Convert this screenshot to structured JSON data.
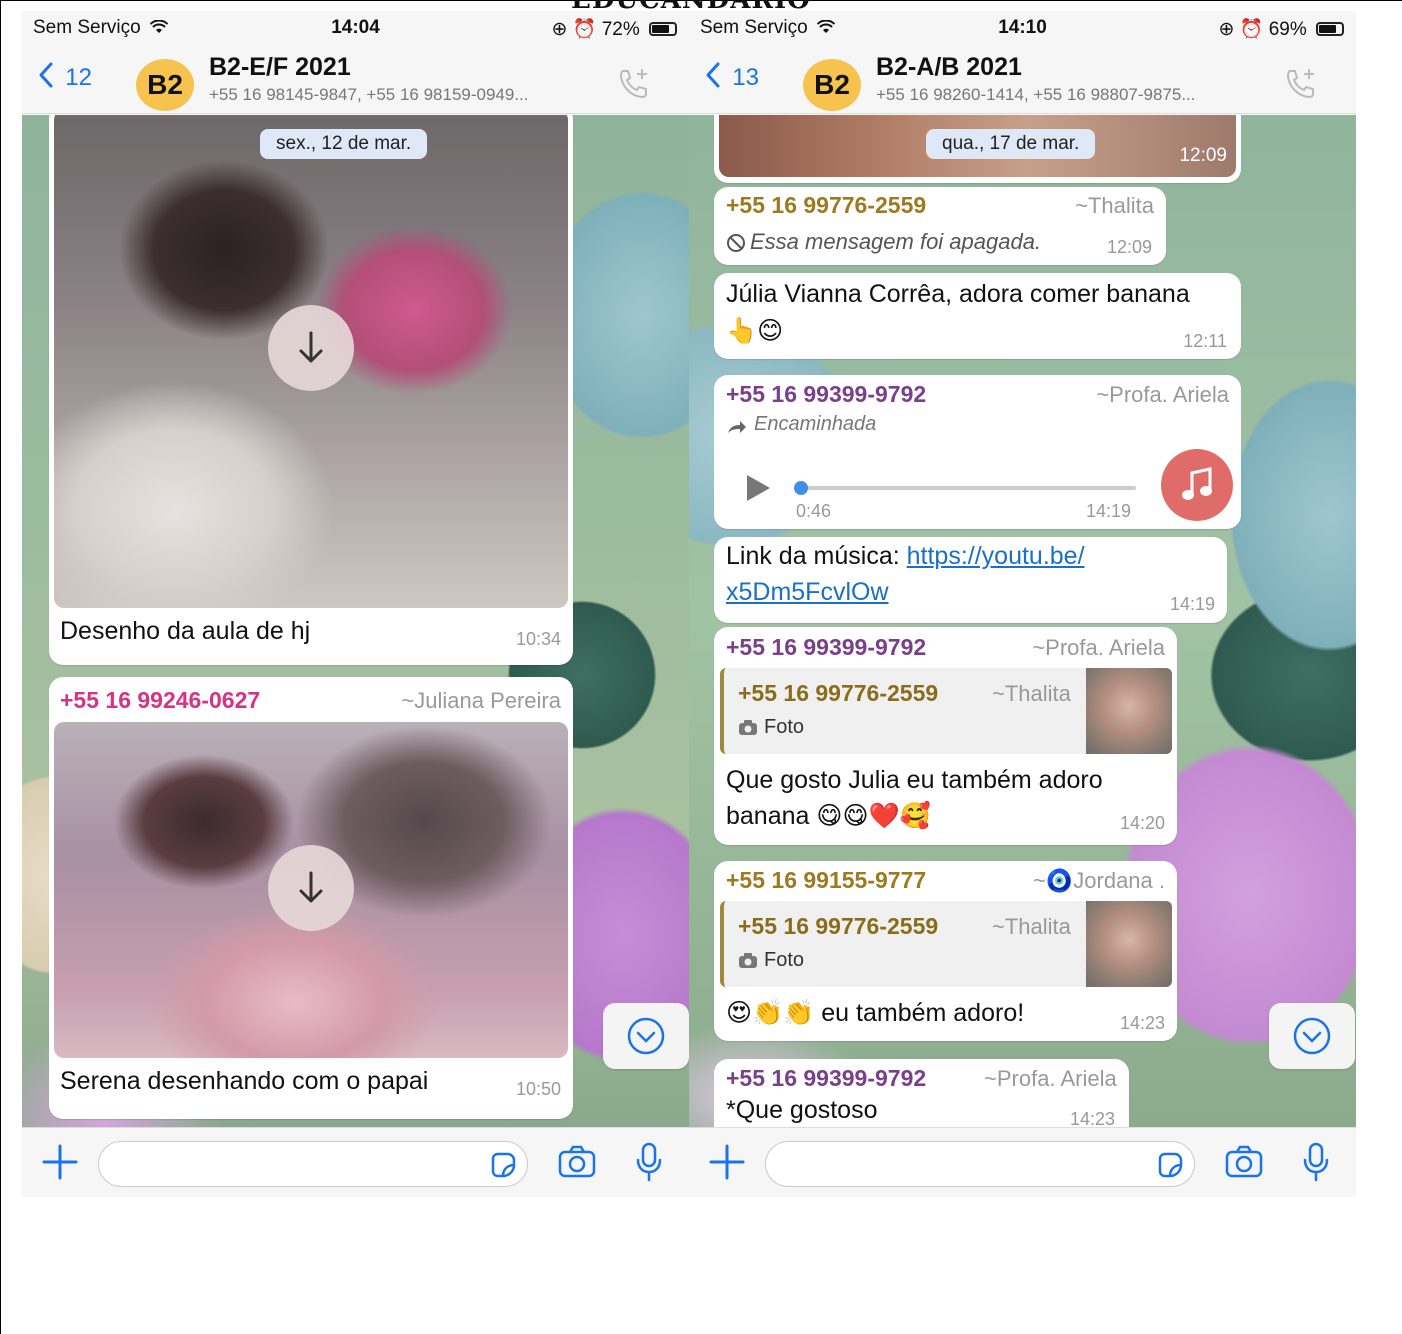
{
  "caption_top": "EDUCANDARIO",
  "left": {
    "status": {
      "carrier": "Sem Serviço",
      "time": "14:04",
      "battery": "72%",
      "battery_level": 0.72
    },
    "header": {
      "back_count": "12",
      "avatar": "B2",
      "title": "B2-E/F 2021",
      "subtitle": "+55 16 98145-9847, +55 16 98159-0949..."
    },
    "date_pill": "sex., 12 de mar.",
    "messages": [
      {
        "caption": "Desenho da aula de hj",
        "time": "10:34"
      },
      {
        "sender": "+55 16 99246-0627",
        "alias": "~Juliana Pereira",
        "caption": "Serena desenhando com o papai",
        "time": "10:50"
      }
    ]
  },
  "right": {
    "status": {
      "carrier": "Sem Serviço",
      "time": "14:10",
      "battery": "69%",
      "battery_level": 0.69
    },
    "header": {
      "back_count": "13",
      "avatar": "B2",
      "title": "B2-A/B 2021",
      "subtitle": "+55 16 98260-1414, +55 16 98807-9875..."
    },
    "date_pill": "qua., 17 de mar.",
    "top_image_time": "12:09",
    "messages": [
      {
        "sender": "+55 16 99776-2559",
        "alias": "~Thalita",
        "text": "Essa mensagem foi apagada.",
        "time": "12:09"
      },
      {
        "text": "Júlia Vianna Corrêa, adora comer banana",
        "emoji": "👆😊",
        "time": "12:11"
      },
      {
        "sender": "+55 16 99399-9792",
        "alias": "~Profa. Ariela",
        "forwarded": "Encaminhada",
        "duration": "0:46",
        "time": "14:19"
      },
      {
        "text_prefix": "Link da música: ",
        "link_line1": "https://youtu.be/",
        "link_line2": "x5Dm5FcvlOw",
        "time": "14:19"
      },
      {
        "sender": "+55 16 99399-9792",
        "alias": "~Profa. Ariela",
        "quote_sender": "+55 16 99776-2559",
        "quote_alias": "~Thalita",
        "quote_label": "Foto",
        "text_line1": "Que gosto Julia eu também adoro",
        "text_line2": "banana",
        "emoji": "😋😋❤️🥰",
        "time": "14:20"
      },
      {
        "sender": "+55 16 99155-9777",
        "alias_prefix": "~",
        "alias_icon": "🧿",
        "alias": "Jordana .",
        "quote_sender": "+55 16 99776-2559",
        "quote_alias": "~Thalita",
        "quote_label": "Foto",
        "emoji": "😍👏👏",
        "text": " eu também adoro!",
        "time": "14:23"
      },
      {
        "sender": "+55 16 99399-9792",
        "alias": "~Profa. Ariela",
        "text": "*Que gostoso",
        "time": "14:23"
      }
    ]
  },
  "colors": {
    "link": "#1a6fc9",
    "sender_gold": "#9d7a1f",
    "sender_purple": "#7a3f8c",
    "sender_pink": "#d63384",
    "sender_olive": "#8a6d1a",
    "ios_blue": "#1a73e8"
  }
}
